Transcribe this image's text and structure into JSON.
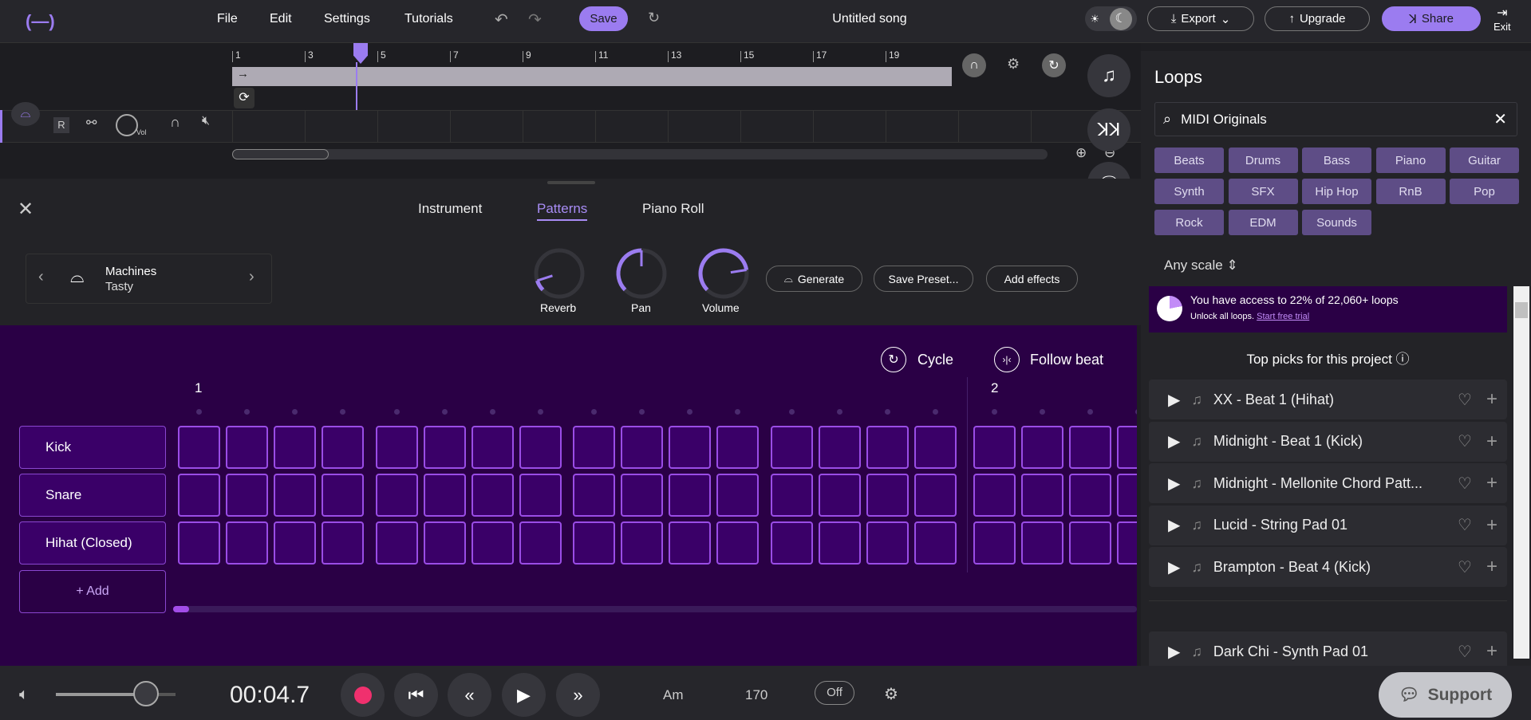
{
  "header": {
    "menu": [
      "File",
      "Edit",
      "Settings",
      "Tutorials"
    ],
    "save": "Save",
    "title": "Untitled song",
    "export": "Export",
    "upgrade": "Upgrade",
    "share": "Share",
    "exit": "Exit"
  },
  "timeline": {
    "ruler": [
      "1",
      "3",
      "5",
      "7",
      "9",
      "11",
      "13",
      "15",
      "17",
      "19"
    ],
    "track": {
      "record": "R",
      "vol": "Vol"
    }
  },
  "panel": {
    "tabs": [
      "Instrument",
      "Patterns",
      "Piano Roll"
    ],
    "active_tab": "Patterns",
    "instrument": {
      "name": "Machines",
      "preset": "Tasty"
    },
    "knobs": [
      {
        "label": "Reverb",
        "value": 0.1
      },
      {
        "label": "Pan",
        "value": 0.5
      },
      {
        "label": "Volume",
        "value": 0.8
      }
    ],
    "buttons": {
      "generate": "Generate",
      "save_preset": "Save Preset...",
      "add_effects": "Add effects"
    }
  },
  "sequencer": {
    "cycle": "Cycle",
    "follow_beat": "Follow beat",
    "bars": [
      "1",
      "2"
    ],
    "rows": [
      "Kick",
      "Snare",
      "Hihat (Closed)"
    ],
    "add": "+ Add"
  },
  "loops": {
    "title": "Loops",
    "search_value": "MIDI Originals",
    "chips": [
      "Beats",
      "Drums",
      "Bass",
      "Piano",
      "Guitar",
      "Synth",
      "SFX",
      "Hip Hop",
      "RnB",
      "Pop",
      "Rock",
      "EDM",
      "Sounds"
    ],
    "scale": "Any scale",
    "banner": {
      "text": "You have access to 22% of 22,060+ loops",
      "sub": "Unlock all loops.",
      "link": "Start free trial",
      "percent": 22
    },
    "top_picks": "Top picks for this project",
    "items": [
      "XX - Beat 1 (Hihat)",
      "Midnight - Beat 1 (Kick)",
      "Midnight - Mellonite Chord Patt...",
      "Lucid - String Pad 01",
      "Brampton - Beat 4 (Kick)",
      "Dark Chi - Synth Pad 01"
    ]
  },
  "transport": {
    "time": "00:04.7",
    "key": "Am",
    "tempo": "170",
    "metronome": "Off",
    "volume": 0.75,
    "support": "Support"
  },
  "colors": {
    "accent": "#9b7cf0",
    "sequencer_bg": "#2a0045",
    "cell_border": "#9a4de6",
    "record": "#f0306e"
  }
}
